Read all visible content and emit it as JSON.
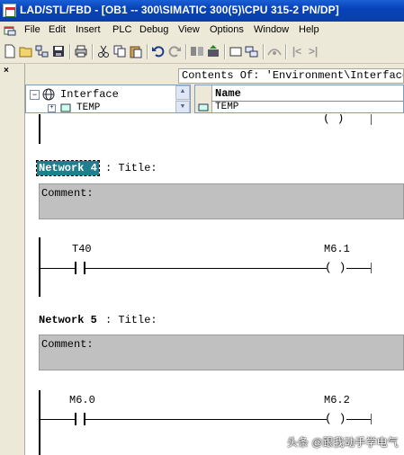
{
  "window": {
    "title": "LAD/STL/FBD  - [OB1 -- 300\\SIMATIC 300(5)\\CPU 315-2 PN/DP]"
  },
  "menu": [
    "File",
    "Edit",
    "Insert",
    "PLC",
    "Debug",
    "View",
    "Options",
    "Window",
    "Help"
  ],
  "toolbar": {
    "icons": [
      "new-icon",
      "open-icon",
      "accessible-nodes-icon",
      "save-icon",
      "print-icon",
      "cut-icon",
      "copy-icon",
      "paste-icon",
      "undo-icon",
      "redo-icon",
      "download-icon",
      "upload-icon",
      "box-icon",
      "network-icon",
      "monitor-icon",
      "goto-first-icon",
      "goto-prev-icon"
    ]
  },
  "interface": {
    "contents_label": "Contents Of: 'Environment\\Interface'",
    "tree_root": "Interface",
    "tree_child": "TEMP",
    "column_name": "Name",
    "row_name": "TEMP"
  },
  "networks": [
    {
      "label": "Network 4",
      "title": ": Title:",
      "comment": "Comment:",
      "contact_operand": "T40",
      "coil_operand": "M6.1",
      "coil_symbol": "( )"
    },
    {
      "label": "Network 5",
      "title": ": Title:",
      "comment": "Comment:",
      "contact_operand": "M6.0",
      "coil_operand": "M6.2",
      "coil_symbol": "( )"
    }
  ],
  "previous_network_coil": "( )",
  "watermark": "头条 @跟我动手学电气",
  "colors": {
    "titlebar": "#0842b8",
    "network_highlight": "#1f7f8c",
    "comment_bg": "#c0c0c0"
  }
}
